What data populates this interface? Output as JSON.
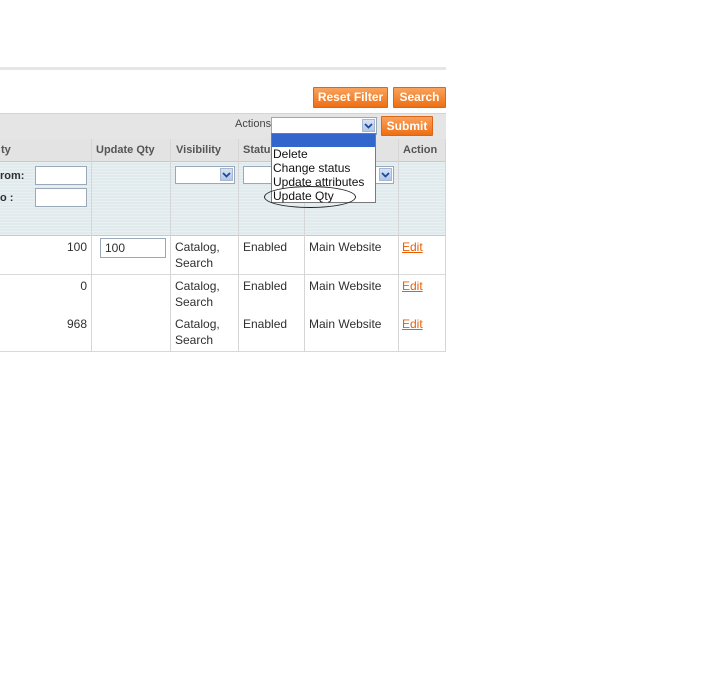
{
  "toolbar": {
    "reset_filter": "Reset Filter",
    "search": "Search"
  },
  "massaction": {
    "label": "Actions",
    "submit": "Submit",
    "selected": ""
  },
  "dropdown_options": [
    "",
    "Delete",
    "Change status",
    "Update attributes",
    "Update Qty"
  ],
  "headers": {
    "qty": "ty",
    "update_qty": "Update Qty",
    "visibility": "Visibility",
    "status": "Statu",
    "action": "Action"
  },
  "filters": {
    "qty_from": "rom:",
    "qty_to": "o :"
  },
  "rows": [
    {
      "qty": "100",
      "update_qty": "100",
      "visibility": "Catalog, Search",
      "vis1": "Catalog,",
      "vis2": "Search",
      "status": "Enabled",
      "website": "Main Website",
      "action": "Edit"
    },
    {
      "qty": "0",
      "update_qty": "",
      "visibility": "Catalog, Search",
      "vis1": "Catalog,",
      "vis2": "Search",
      "status": "Enabled",
      "website": "Main Website",
      "action": "Edit"
    },
    {
      "qty": "968",
      "update_qty": "",
      "visibility": "Catalog, Search",
      "vis1": "Catalog,",
      "vis2": "Search",
      "status": "Enabled",
      "website": "Main Website",
      "action": "Edit"
    }
  ],
  "colors": {
    "button_orange": "#f17e2b",
    "link_orange": "#eb5e00",
    "filter_bg": "#e1ebee"
  }
}
